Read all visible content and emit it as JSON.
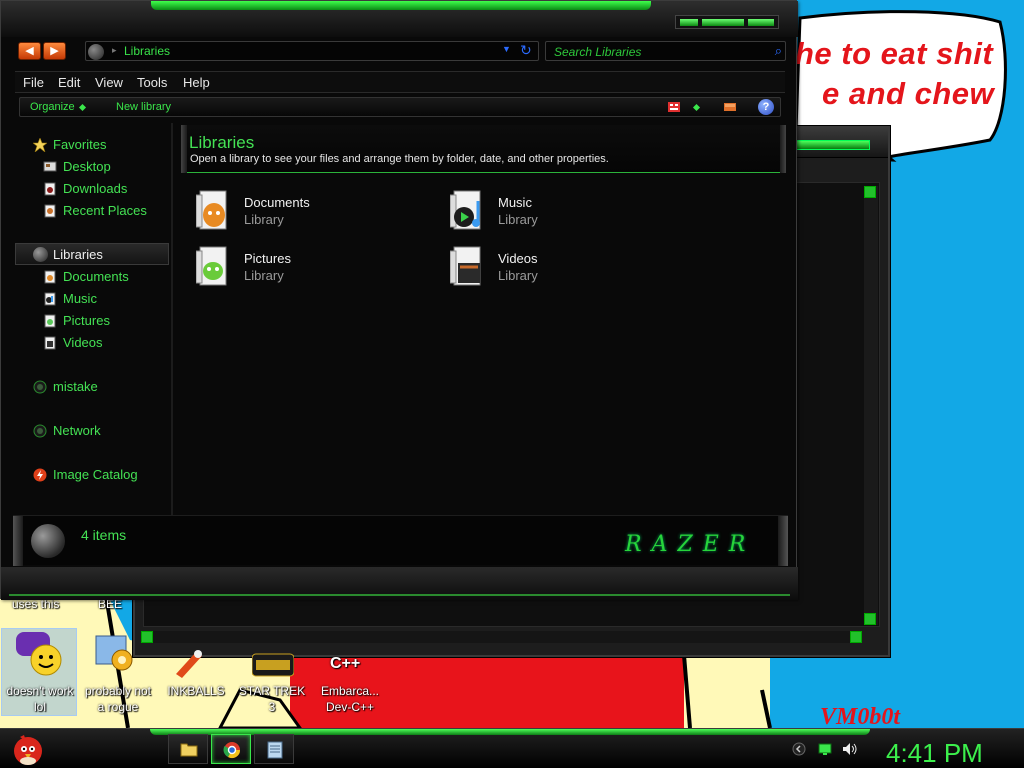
{
  "wallpaper": {
    "bubble_line1": "he to eat shit",
    "bubble_line2": "e and chew",
    "signature": "VM0b0t"
  },
  "window": {
    "address_path": "Libraries",
    "search_placeholder": "Search Libraries",
    "menu": [
      "File",
      "Edit",
      "View",
      "Tools",
      "Help"
    ],
    "commands": {
      "organize": "Organize",
      "new_library": "New library",
      "help": "?"
    },
    "sidebar": {
      "favorites": "Favorites",
      "favorites_items": [
        "Desktop",
        "Downloads",
        "Recent Places"
      ],
      "libraries": "Libraries",
      "libraries_items": [
        "Documents",
        "Music",
        "Pictures",
        "Videos"
      ],
      "others": [
        "mistake",
        "Network",
        "Image Catalog"
      ]
    },
    "banner": {
      "title": "Libraries",
      "description": "Open a library to see your files and arrange them by folder, date, and other properties."
    },
    "libraries": [
      {
        "name": "Documents",
        "kind": "Library"
      },
      {
        "name": "Music",
        "kind": "Library"
      },
      {
        "name": "Pictures",
        "kind": "Library"
      },
      {
        "name": "Videos",
        "kind": "Library"
      }
    ],
    "status": {
      "count": "4 items",
      "brand": "RAZER"
    }
  },
  "desktop": {
    "partial_labels": [
      "uses this",
      "BEE"
    ],
    "icons": [
      {
        "label_line1": "doesn't work",
        "label_line2": "lol"
      },
      {
        "label_line1": "probably not",
        "label_line2": "a rogue"
      },
      {
        "label_line1": "INKBALLS",
        "label_line2": ""
      },
      {
        "label_line1": "STAR TREK",
        "label_line2": "3"
      },
      {
        "label_line1": "Embarca...",
        "label_line2": "Dev-C++"
      }
    ],
    "cpp_badge": "C++"
  },
  "taskbar": {
    "clock": "4:41 PM"
  },
  "colors": {
    "accent_green": "#44e254",
    "desktop_blue": "#12a8e6",
    "wallpaper_red": "#e4151b",
    "window_bg": "#090909"
  }
}
